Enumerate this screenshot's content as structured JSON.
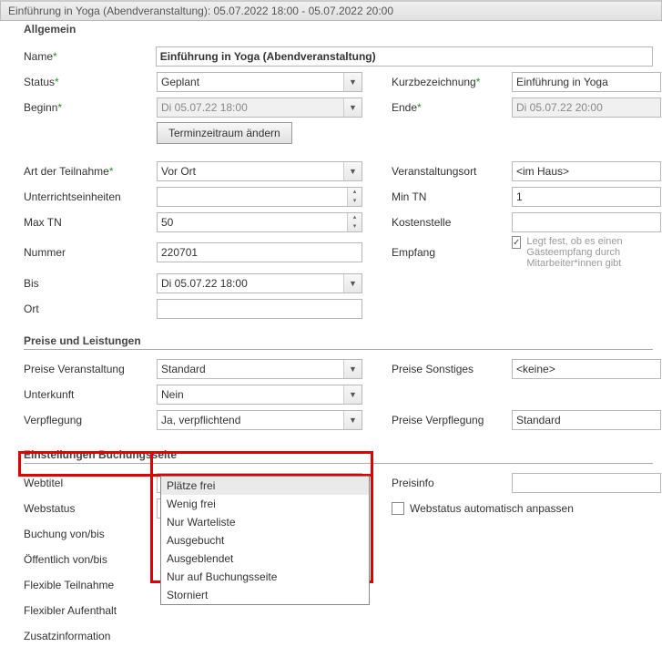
{
  "titlebar": "Einführung in Yoga (Abendveranstaltung): 05.07.2022 18:00 - 05.07.2022 20:00",
  "section_allgemein": "Allgemein",
  "name_label": "Name",
  "name_value": "Einführung in Yoga (Abendveranstaltung)",
  "status_label": "Status",
  "status_value": "Geplant",
  "kurz_label": "Kurzbezeichnung",
  "kurz_value": "Einführung in Yoga",
  "beginn_label": "Beginn",
  "beginn_value": "Di 05.07.22 18:00",
  "ende_label": "Ende",
  "ende_value": "Di 05.07.22 20:00",
  "btn_terminzeitraum": "Terminzeitraum ändern",
  "art_label": "Art der Teilnahme",
  "art_value": "Vor Ort",
  "vort_label": "Veranstaltungsort",
  "vort_value": "<im Haus>",
  "ue_label": "Unterrichtseinheiten",
  "ue_value": "",
  "mintn_label": "Min TN",
  "mintn_value": "1",
  "maxtn_label": "Max TN",
  "maxtn_value": "50",
  "kosten_label": "Kostenstelle",
  "kosten_value": "",
  "nummer_label": "Nummer",
  "nummer_value": "220701",
  "empfang_label": "Empfang",
  "empfang_hint": "Legt fest, ob es einen Gästeempfang durch Mitarbeiter*innen gibt",
  "bis_label": "Bis",
  "bis_value": "Di 05.07.22 18:00",
  "ort_label": "Ort",
  "ort_value": "",
  "section_preise": "Preise und Leistungen",
  "pv_label": "Preise Veranstaltung",
  "pv_value": "Standard",
  "ps_label": "Preise Sonstiges",
  "ps_value": "<keine>",
  "unterkunft_label": "Unterkunft",
  "unterkunft_value": "Nein",
  "verpfleg_label": "Verpflegung",
  "verpfleg_value": "Ja, verpflichtend",
  "pverpfleg_label": "Preise Verpflegung",
  "pverpfleg_value": "Standard",
  "section_buchung": "Einstellungen Buchungsseite",
  "webtitel_label": "Webtitel",
  "preisinfo_label": "Preisinfo",
  "webstatus_label": "Webstatus",
  "webstatus_value": "Plätze frei",
  "webstatus_auto": "Webstatus automatisch anpassen",
  "buchung_label": "Buchung von/bis",
  "oeffentlich_label": "Öffentlich von/bis",
  "flexteil_label": "Flexible Teilnahme",
  "flexauf_label": "Flexibler Aufenthalt",
  "zusatz_label": "Zusatzinformation",
  "dropdown_options": {
    "0": "Plätze frei",
    "1": "Wenig frei",
    "2": "Nur Warteliste",
    "3": "Ausgebucht",
    "4": "Ausgeblendet",
    "5": "Nur auf Buchungsseite",
    "6": "Storniert"
  }
}
